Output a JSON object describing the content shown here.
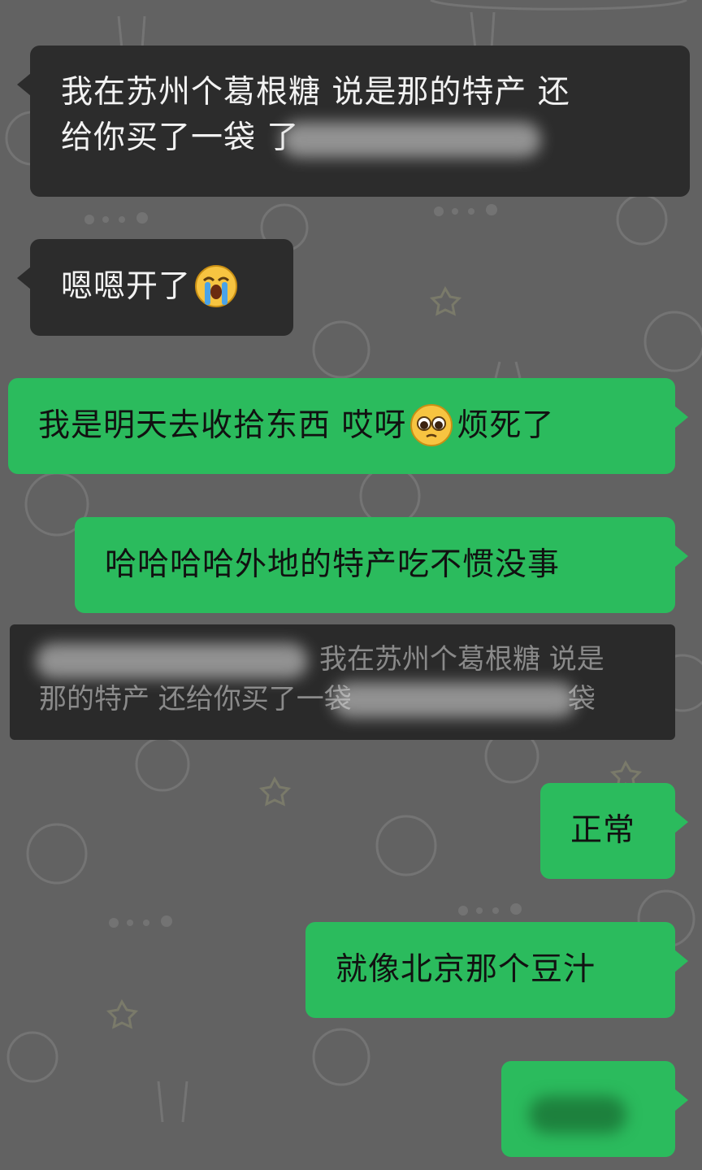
{
  "messages": [
    {
      "id": "m1",
      "side": "left",
      "text_line1": "我在苏州个葛根糖 说是那的特产 还",
      "text_line2_visible": "给你买了一袋 ",
      "text_line2_tail": "了"
    },
    {
      "id": "m2",
      "side": "left",
      "text": "嗯嗯开了",
      "emoji": "loudly-crying-face"
    },
    {
      "id": "m3",
      "side": "right",
      "text_before": "我是明天去收拾东西 哎呀",
      "emoji": "pleading-face",
      "text_after": "烦死了"
    },
    {
      "id": "m4",
      "side": "right",
      "text": "哈哈哈哈外地的特产吃不惯没事"
    },
    {
      "id": "m5",
      "side": "right",
      "text": "正常"
    },
    {
      "id": "m6",
      "side": "right",
      "text": "就像北京那个豆汁"
    },
    {
      "id": "m7",
      "side": "right",
      "text": "",
      "blurred": true
    }
  ],
  "quote": {
    "line1_text": "我在苏州个葛根糖 说是",
    "line2_visible": "那的特产 还给你买了一袋",
    "line2_tail": "袋"
  },
  "colors": {
    "background": "#626262",
    "incoming_bubble": "#2c2c2c",
    "outgoing_bubble": "#2bbb5d",
    "quote_bg": "#2a2a2a"
  }
}
